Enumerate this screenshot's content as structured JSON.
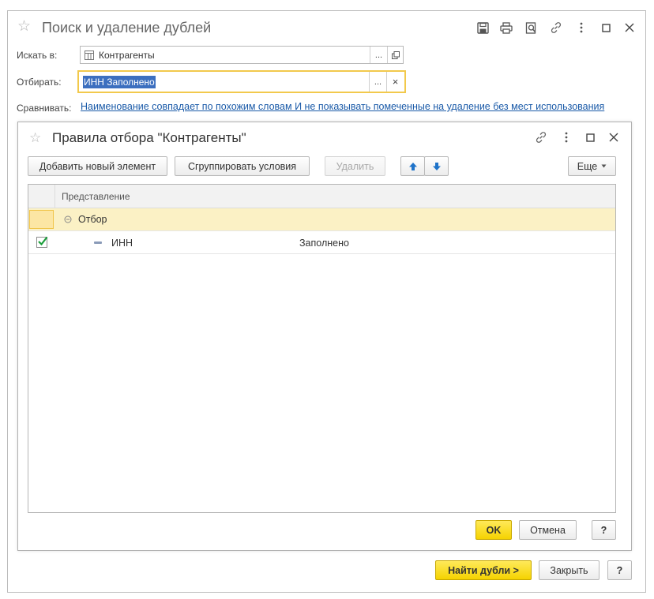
{
  "window": {
    "title": "Поиск и удаление дублей",
    "search_in_label": "Искать в:",
    "search_in_value": "Контрагенты",
    "filter_label": "Отбирать:",
    "filter_value": "ИНН Заполнено",
    "compare_label": "Сравнивать:",
    "compare_link": "Наименование совпадает по похожим словам И не показывать помеченные на удаление без мест использования",
    "ellipsis": "...",
    "clear": "×",
    "find_button": "Найти дубли >",
    "close_button": "Закрыть",
    "help_button": "?"
  },
  "dialog": {
    "title": "Правила отбора \"Контрагенты\"",
    "add_button": "Добавить новый элемент",
    "group_button": "Сгруппировать условия",
    "delete_button": "Удалить",
    "more_button": "Еще",
    "grid_header": "Представление",
    "rows": [
      {
        "label": "Отбор",
        "value": ""
      },
      {
        "label": "ИНН",
        "value": "Заполнено",
        "checked": true
      }
    ],
    "ok_button": "OK",
    "cancel_button": "Отмена",
    "help_button": "?"
  },
  "colors": {
    "accent_yellow": "#f5d300",
    "link": "#1a5aa8",
    "selection": "#fbf1c5",
    "check": "#1a9e3a",
    "arrow": "#1f73c9"
  }
}
